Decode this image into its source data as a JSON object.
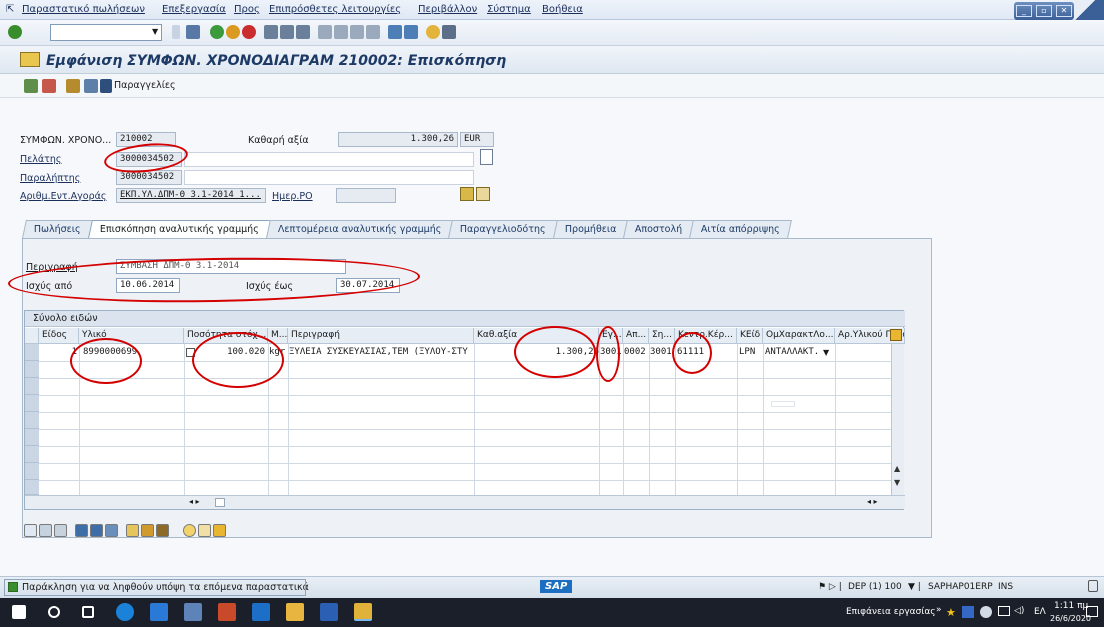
{
  "menubar": {
    "items": [
      "Παραστατικό πωλήσεων",
      "Επεξεργασία",
      "Προς",
      "Επιπρόσθετες λειτουργίες",
      "Περιβάλλον",
      "Σύστημα",
      "Βοήθεια"
    ]
  },
  "header": {
    "title": "Εμφάνιση ΣΥΜΦΩΝ. ΧΡΟΝΟΔΙΑΓΡΑΜ 210002: Επισκόπηση"
  },
  "apptoolbar": {
    "orders_label": "Παραγγελίες"
  },
  "form": {
    "agreement_label": "ΣΥΜΦΩΝ. ΧΡΟΝΟ...",
    "agreement_value": "210002",
    "net_value_label": "Καθαρή αξία",
    "net_value": "1.300,26",
    "currency": "EUR",
    "customer_label": "Πελάτης",
    "customer_value": "3000034502",
    "recipient_label": "Παραλήπτης",
    "recipient_value": "3000034502",
    "po_label": "Αριθμ.Εντ.Αγοράς",
    "po_value": "ΕΚΠ.ΥΛ.ΔΠΜ-Θ 3.1-2014 1...",
    "po_date_label": "Ημερ.ΡΟ",
    "po_date_value": ""
  },
  "tabs": [
    {
      "label": "Πωλήσεις"
    },
    {
      "label": "Επισκόπηση αναλυτικής γραμμής"
    },
    {
      "label": "Λεπτομέρεια αναλυτικής γραμμής"
    },
    {
      "label": "Παραγγελιοδότης"
    },
    {
      "label": "Προμήθεια"
    },
    {
      "label": "Αποστολή"
    },
    {
      "label": "Αιτία απόρριψης"
    }
  ],
  "panel": {
    "description_label": "Περιγραφή",
    "description_value": "ΣΥΜΒΑΣΗ ΔΠΜ-Θ 3.1-2014",
    "valid_from_label": "Ισχύς από",
    "valid_from_value": "10.06.2014",
    "valid_to_label": "Ισχύς έως",
    "valid_to_value": "30.07.2014"
  },
  "table": {
    "title": "Σύνολο ειδών",
    "columns": [
      "Είδος",
      "Υλικό",
      "Ποσότητα στόχ...",
      "Μ...",
      "Περιγραφή",
      "Καθ.αξία",
      "Εγ...",
      "Απ...",
      "Ση...",
      "Κεντρ.Κέρ...",
      "ΚΕίδ",
      "ΟμΧαρακτΛο...",
      "Αρ.Υλικού Πελάτη"
    ],
    "rows": [
      {
        "item": "1",
        "material": "8990000699",
        "qty": "100.020",
        "unit": "kgr",
        "desc": "ΞΥΛΕΙΑ ΣΥΣΚΕΥΑΣΙΑΣ,ΤΕΜ (ΞΥΛΟΥ-ΣΤΥ",
        "net": "1.300,26",
        "c1": "3001",
        "c2": "0002",
        "c3": "3001",
        "profit": "61111",
        "cat": "LPN",
        "group": "ΑΝΤΑΛΛΑΚΤ..."
      }
    ]
  },
  "status": {
    "message": "Παράκληση για να ληφθούν υπόψη τα επόμενα παραστατικά",
    "sap_logo": "SAP",
    "system": "DEP (1) 100",
    "server": "SAPHAP01ERP",
    "mode": "INS"
  },
  "taskbar": {
    "desktop_label": "Επιφάνεια εργασίας",
    "lang": "ΕΛ",
    "time": "1:11 πμ",
    "date": "26/6/2020"
  }
}
